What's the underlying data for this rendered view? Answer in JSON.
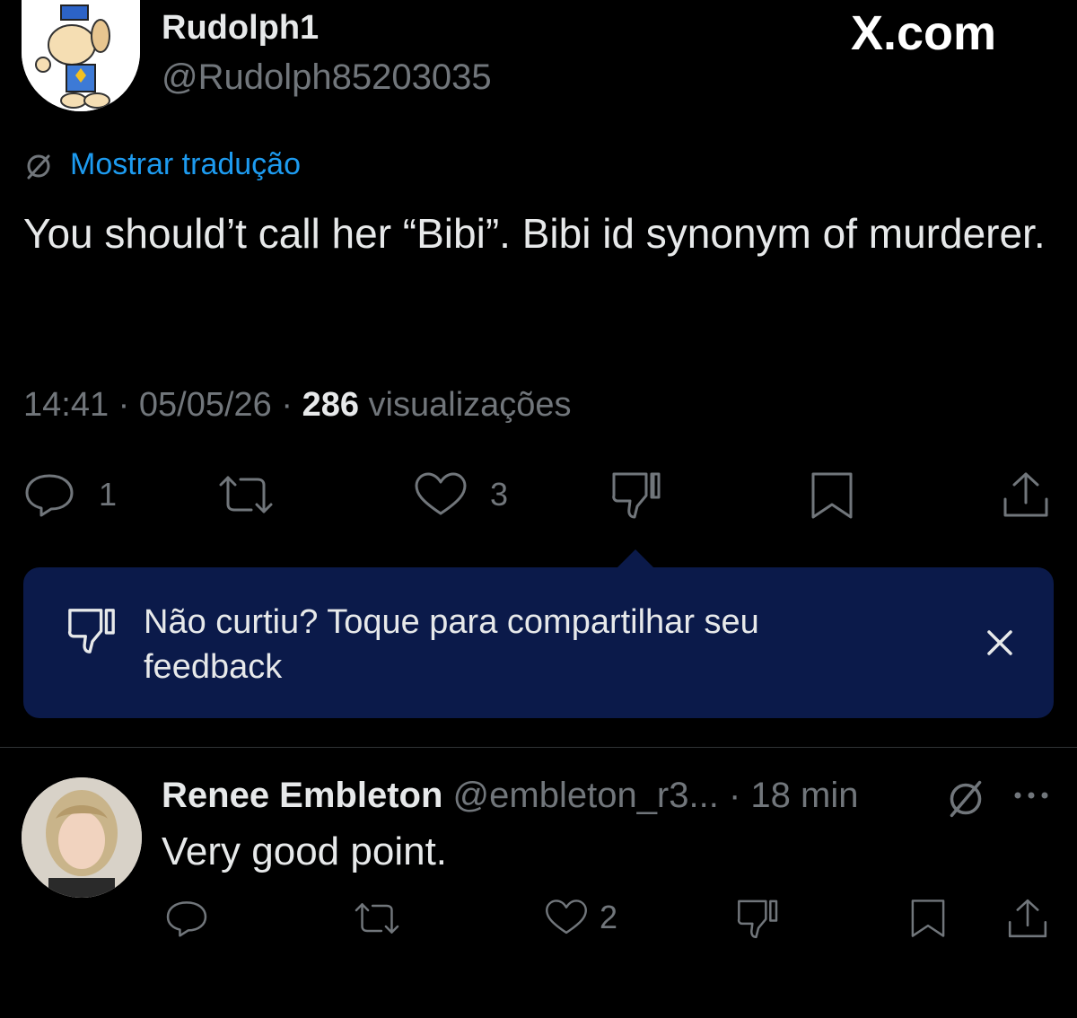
{
  "post": {
    "author_name": "Rudolph1",
    "author_handle": "@Rudolph85203035",
    "show_translation": "Mostrar tradução",
    "text": "You should’t call her “Bibi”. Bibi id synonym of murderer.",
    "time": "14:41",
    "date": "05/05/26",
    "views_count": "286",
    "views_label": "visualizações",
    "sep": "·",
    "reply_count": "1",
    "like_count": "3"
  },
  "watermark": "X.com",
  "toast": {
    "text": "Não curtiu? Toque para compartilhar seu feedback"
  },
  "reply": {
    "author_name": "Renee Embleton",
    "author_handle": "@embleton_r3...",
    "sep": "·",
    "time": "18 min",
    "text": "Very good point.",
    "like_count": "2"
  },
  "colors": {
    "background": "#000000",
    "text": "#e7e9ea",
    "muted": "#71767b",
    "link": "#1d9bf0",
    "toast_bg": "#0b1a4a"
  },
  "icons": [
    "reply-icon",
    "retweet-icon",
    "like-icon",
    "dislike-icon",
    "bookmark-icon",
    "share-icon",
    "close-icon",
    "translate-icon",
    "more-icon"
  ]
}
